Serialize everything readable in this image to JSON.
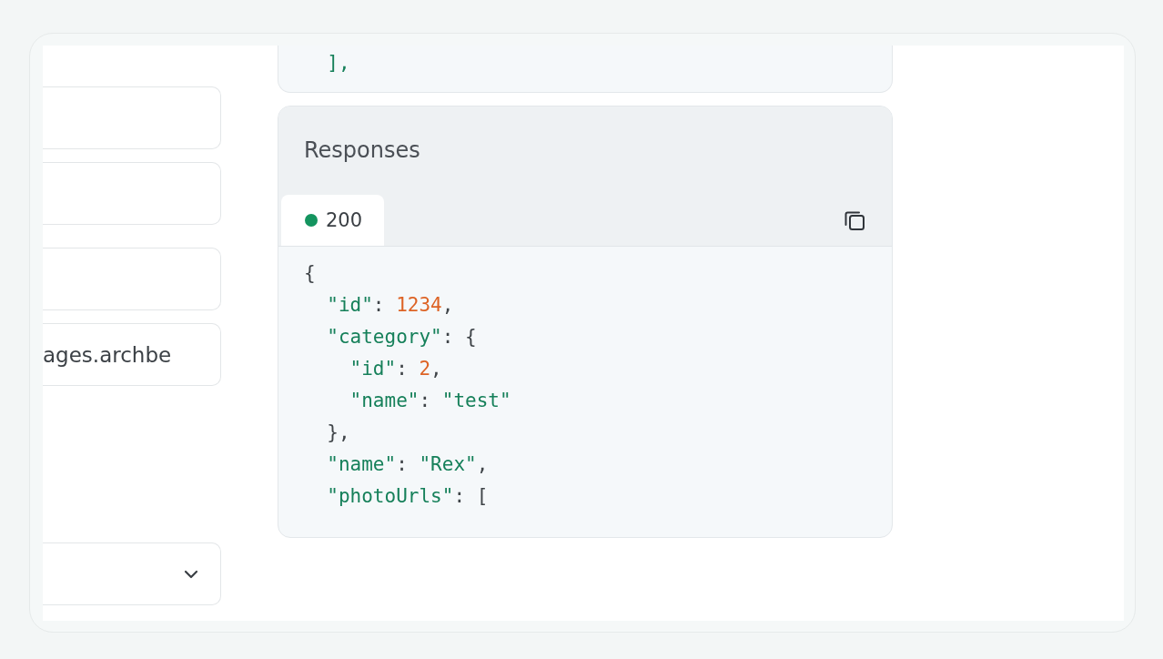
{
  "form_fields": [
    {
      "kind": "input"
    },
    {
      "kind": "input"
    },
    {
      "kind": "input"
    },
    {
      "kind": "input",
      "value": "ages.archbe"
    },
    {
      "kind": "select"
    }
  ],
  "request_code": {
    "lines": [
      [
        {
          "kind": "bracket",
          "text": "  ],"
        }
      ]
    ]
  },
  "responses": {
    "title": "Responses",
    "tabs": [
      {
        "label": "200",
        "color": "#14945f",
        "selected": true
      }
    ],
    "code_lines": [
      [
        {
          "kind": "punct",
          "text": "{"
        }
      ],
      [
        {
          "kind": "key",
          "text": "  \"id\""
        },
        {
          "kind": "punct",
          "text": ": "
        },
        {
          "kind": "number",
          "text": "1234"
        },
        {
          "kind": "punct",
          "text": ","
        }
      ],
      [
        {
          "kind": "key",
          "text": "  \"category\""
        },
        {
          "kind": "punct",
          "text": ": {"
        }
      ],
      [
        {
          "kind": "key",
          "text": "    \"id\""
        },
        {
          "kind": "punct",
          "text": ": "
        },
        {
          "kind": "number",
          "text": "2"
        },
        {
          "kind": "punct",
          "text": ","
        }
      ],
      [
        {
          "kind": "key",
          "text": "    \"name\""
        },
        {
          "kind": "punct",
          "text": ": "
        },
        {
          "kind": "string",
          "text": "\"test\""
        }
      ],
      [
        {
          "kind": "punct",
          "text": "  },"
        }
      ],
      [
        {
          "kind": "key",
          "text": "  \"name\""
        },
        {
          "kind": "punct",
          "text": ": "
        },
        {
          "kind": "string",
          "text": "\"Rex\""
        },
        {
          "kind": "punct",
          "text": ","
        }
      ],
      [
        {
          "kind": "key",
          "text": "  \"photoUrls\""
        },
        {
          "kind": "punct",
          "text": ": ["
        }
      ]
    ]
  }
}
